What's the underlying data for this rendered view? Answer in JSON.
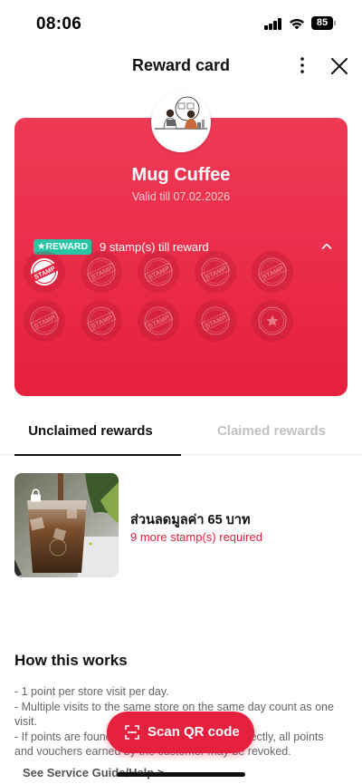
{
  "status_bar": {
    "time": "08:06",
    "battery": "85"
  },
  "header": {
    "title": "Reward card"
  },
  "card": {
    "shop_name": "Mug Cuffee",
    "valid_till": "Valid till 07.02.2026",
    "reward_badge": "★REWARD",
    "stamps_till_reward": "9 stamp(s) till reward",
    "stamp_text": "STAMP",
    "stamps_total": 10,
    "stamps_collected": 1,
    "accent_color": "#e6203f"
  },
  "tabs": [
    {
      "label": "Unclaimed rewards",
      "active": true
    },
    {
      "label": "Claimed rewards",
      "active": false
    }
  ],
  "reward": {
    "name": "ส่วนลดมูลค่า 65 บาท",
    "requirement": "9 more stamp(s) required"
  },
  "how_it_works": {
    "title": "How this works",
    "lines": [
      "- 1 point per store visit per day.",
      "- Multiple visits to the same store on the same day count as one visit.",
      "- If points are found to have been earned incorrectly, all points and vouchers earned by the customer may be revoked."
    ]
  },
  "service_guide_link": "See Service Guide/Help >",
  "scan_button": {
    "label": "Scan QR code"
  }
}
